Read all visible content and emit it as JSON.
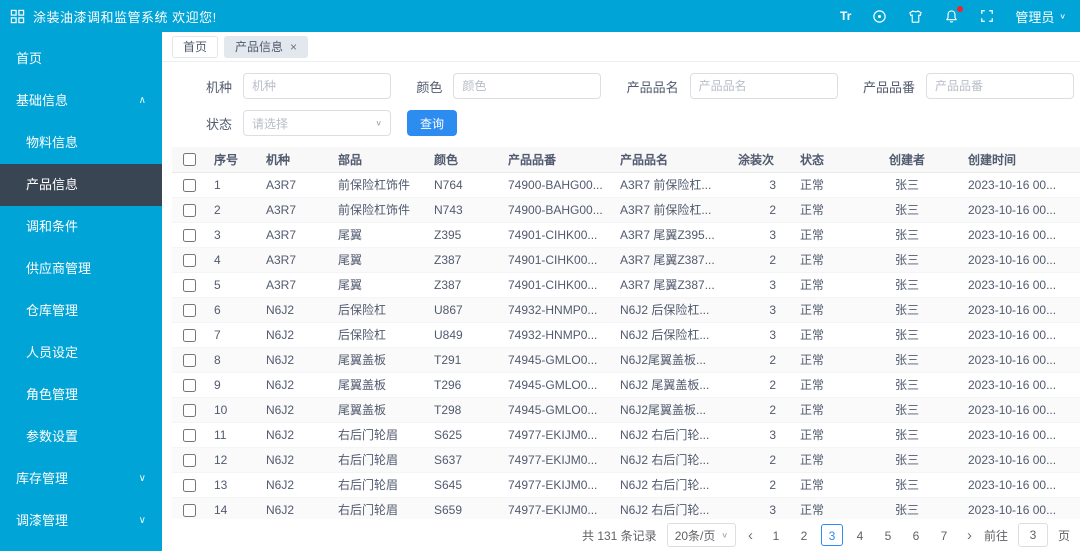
{
  "header": {
    "title": "涂装油漆调和监管系统 欢迎您!",
    "text_icon": "Tr",
    "user_label": "管理员"
  },
  "sidebar": {
    "items": [
      {
        "label": "首页",
        "level": "root"
      },
      {
        "label": "基础信息",
        "level": "root",
        "caret": "up"
      },
      {
        "label": "物料信息",
        "level": "sub"
      },
      {
        "label": "产品信息",
        "level": "sub",
        "active": true
      },
      {
        "label": "调和条件",
        "level": "sub"
      },
      {
        "label": "供应商管理",
        "level": "sub"
      },
      {
        "label": "仓库管理",
        "level": "sub"
      },
      {
        "label": "人员设定",
        "level": "sub"
      },
      {
        "label": "角色管理",
        "level": "sub"
      },
      {
        "label": "参数设置",
        "level": "sub"
      },
      {
        "label": "库存管理",
        "level": "root",
        "caret": "down"
      },
      {
        "label": "调漆管理",
        "level": "root",
        "caret": "down"
      }
    ]
  },
  "tabs": {
    "items": [
      {
        "label": "首页",
        "active": false,
        "closable": false
      },
      {
        "label": "产品信息",
        "active": true,
        "closable": true
      }
    ]
  },
  "filters": {
    "fields": [
      {
        "label": "机种",
        "placeholder": "机种",
        "type": "input"
      },
      {
        "label": "颜色",
        "placeholder": "颜色",
        "type": "input"
      },
      {
        "label": "产品品名",
        "placeholder": "产品品名",
        "type": "input"
      },
      {
        "label": "产品品番",
        "placeholder": "产品品番",
        "type": "input"
      },
      {
        "label": "状态",
        "placeholder": "请选择",
        "type": "select"
      }
    ],
    "search_label": "查询"
  },
  "table": {
    "columns": [
      "序号",
      "机种",
      "部品",
      "颜色",
      "产品品番",
      "产品品名",
      "涂装次",
      "状态",
      "创建者",
      "创建时间"
    ],
    "rows": [
      [
        "1",
        "A3R7",
        "前保险杠饰件",
        "N764",
        "74900-BAHG00...",
        "A3R7 前保险杠...",
        "3",
        "正常",
        "张三",
        "2023-10-16 00..."
      ],
      [
        "2",
        "A3R7",
        "前保险杠饰件",
        "N743",
        "74900-BAHG00...",
        "A3R7 前保险杠...",
        "2",
        "正常",
        "张三",
        "2023-10-16 00..."
      ],
      [
        "3",
        "A3R7",
        "尾翼",
        "Z395",
        "74901-CIHK00...",
        "A3R7 尾翼Z395...",
        "3",
        "正常",
        "张三",
        "2023-10-16 00..."
      ],
      [
        "4",
        "A3R7",
        "尾翼",
        "Z387",
        "74901-CIHK00...",
        "A3R7 尾翼Z387...",
        "2",
        "正常",
        "张三",
        "2023-10-16 00..."
      ],
      [
        "5",
        "A3R7",
        "尾翼",
        "Z387",
        "74901-CIHK00...",
        "A3R7 尾翼Z387...",
        "3",
        "正常",
        "张三",
        "2023-10-16 00..."
      ],
      [
        "6",
        "N6J2",
        "后保险杠",
        "U867",
        "74932-HNMP0...",
        "N6J2 后保险杠...",
        "3",
        "正常",
        "张三",
        "2023-10-16 00..."
      ],
      [
        "7",
        "N6J2",
        "后保险杠",
        "U849",
        "74932-HNMP0...",
        "N6J2 后保险杠...",
        "3",
        "正常",
        "张三",
        "2023-10-16 00..."
      ],
      [
        "8",
        "N6J2",
        "尾翼盖板",
        "T291",
        "74945-GMLO0...",
        "N6J2尾翼盖板...",
        "2",
        "正常",
        "张三",
        "2023-10-16 00..."
      ],
      [
        "9",
        "N6J2",
        "尾翼盖板",
        "T296",
        "74945-GMLO0...",
        "N6J2 尾翼盖板...",
        "2",
        "正常",
        "张三",
        "2023-10-16 00..."
      ],
      [
        "10",
        "N6J2",
        "尾翼盖板",
        "T298",
        "74945-GMLO0...",
        "N6J2尾翼盖板...",
        "2",
        "正常",
        "张三",
        "2023-10-16 00..."
      ],
      [
        "11",
        "N6J2",
        "右后门轮眉",
        "S625",
        "74977-EKIJM0...",
        "N6J2 右后门轮...",
        "3",
        "正常",
        "张三",
        "2023-10-16 00..."
      ],
      [
        "12",
        "N6J2",
        "右后门轮眉",
        "S637",
        "74977-EKIJM0...",
        "N6J2 右后门轮...",
        "2",
        "正常",
        "张三",
        "2023-10-16 00..."
      ],
      [
        "13",
        "N6J2",
        "右后门轮眉",
        "S645",
        "74977-EKIJM0...",
        "N6J2 右后门轮...",
        "2",
        "正常",
        "张三",
        "2023-10-16 00..."
      ],
      [
        "14",
        "N6J2",
        "右后门轮眉",
        "S659",
        "74977-EKIJM0...",
        "N6J2 右后门轮...",
        "3",
        "正常",
        "张三",
        "2023-10-16 00..."
      ]
    ]
  },
  "pagination": {
    "total_text": "共 131 条记录",
    "page_size_text": "20条/页",
    "pages": [
      "1",
      "2",
      "3",
      "4",
      "5",
      "6",
      "7"
    ],
    "active_page": "3",
    "prev_icon": "‹",
    "next_icon": "›",
    "goto_label": "前往",
    "goto_value": "3",
    "page_unit": "页"
  },
  "colors": {
    "primary": "#00a4d6",
    "accent_blue": "#2d8cf0",
    "active_menu_bg": "#3a4553",
    "notification_dot": "#f5222d"
  }
}
